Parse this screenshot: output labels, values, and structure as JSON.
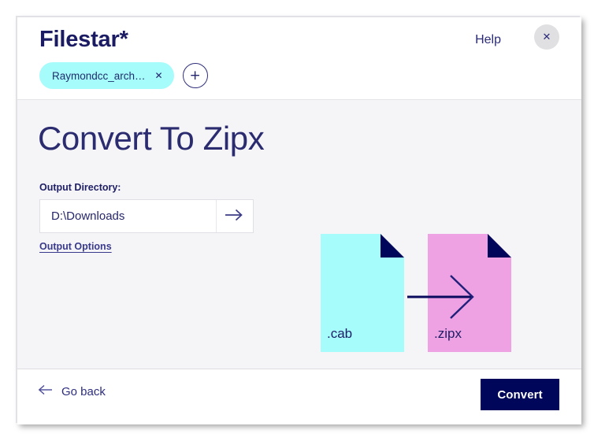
{
  "colors": {
    "navy": "#000659",
    "title_navy": "#2b2b70",
    "cyan": "#a6fbfb",
    "pink": "#eea2e4",
    "content_bg": "#f5f5f7",
    "chip_bg": "#a6fbfb",
    "close_bg": "#e0e0e2"
  },
  "header": {
    "brand": "Filestar",
    "brand_mark": "*",
    "help_label": "Help",
    "close_icon": "close-icon",
    "tabs": [
      {
        "label": "Raymondcc_arch…",
        "close_icon": "close-icon"
      }
    ],
    "add_tab_icon": "plus-icon"
  },
  "main": {
    "title": "Convert To Zipx",
    "output_directory": {
      "label": "Output Directory:",
      "value": "D:\\Downloads",
      "placeholder": "Output directory",
      "go_icon": "arrow-right-icon"
    },
    "output_options_label": "Output Options"
  },
  "illustration": {
    "source_label": ".cab",
    "target_label": ".zipx",
    "arrow_icon": "arrow-right-icon",
    "source_color": "#a6fbfb",
    "target_color": "#eea2e4",
    "fold_color": "#000659"
  },
  "footer": {
    "back_icon": "arrow-left-icon",
    "back_label": "Go back",
    "convert_label": "Convert"
  }
}
